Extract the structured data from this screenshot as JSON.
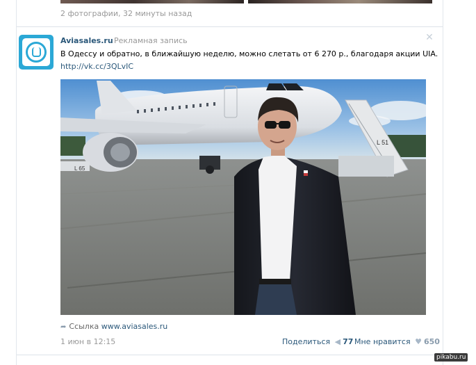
{
  "previous_post": {
    "meta": "2 фотографии, 32 минуты назад"
  },
  "post": {
    "author": "Aviasales.ru",
    "ad_label": "Рекламная запись",
    "text": "В Одессу и обратно, в ближайшую неделю, можно слетать от 6 270 р., благодаря акции UIA.",
    "link": "http://vk.cc/3QLvIC",
    "photo": {
      "plane_labels": [
        "L 65",
        "L 51"
      ]
    },
    "attachment": {
      "prefix": "Ссылка",
      "url": "www.aviasales.ru"
    },
    "date": "1 июн в 12:15",
    "share_label": "Поделиться",
    "share_count": "77",
    "like_label": "Мне нравится",
    "like_count": "650"
  },
  "watermark": "pikabu.ru",
  "colors": {
    "link": "#2b587a",
    "brand": "#2ba8d6",
    "muted": "#999999"
  }
}
